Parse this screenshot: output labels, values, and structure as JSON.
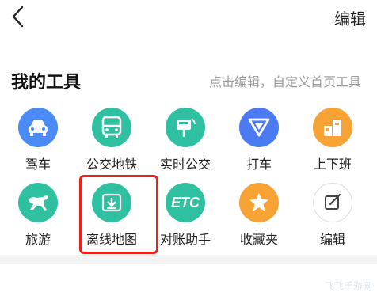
{
  "header": {
    "edit_label": "编辑"
  },
  "section": {
    "title": "我的工具",
    "hint": "点击编辑，自定义首页工具"
  },
  "tools": [
    {
      "label": "驾车",
      "icon": "car-icon",
      "color": "#4b8bf5"
    },
    {
      "label": "公交地铁",
      "icon": "bus-icon",
      "color": "#2fc0a2"
    },
    {
      "label": "实时公交",
      "icon": "bus-stop-icon",
      "color": "#2fc0a2"
    },
    {
      "label": "打车",
      "icon": "taxi-icon",
      "color": "#4b7bf3"
    },
    {
      "label": "上下班",
      "icon": "commute-icon",
      "color": "#f7a234"
    },
    {
      "label": "旅游",
      "icon": "horse-icon",
      "color": "#2fc0a2"
    },
    {
      "label": "离线地图",
      "icon": "download-icon",
      "color": "#2fc0a2"
    },
    {
      "label": "对账助手",
      "icon": "etc-icon",
      "color": "#2fc0a2",
      "text": "ETC"
    },
    {
      "label": "收藏夹",
      "icon": "star-icon",
      "color": "#f7a234"
    },
    {
      "label": "编辑",
      "icon": "edit-icon",
      "color": "#ffffff"
    }
  ],
  "watermark": "飞飞手游网"
}
